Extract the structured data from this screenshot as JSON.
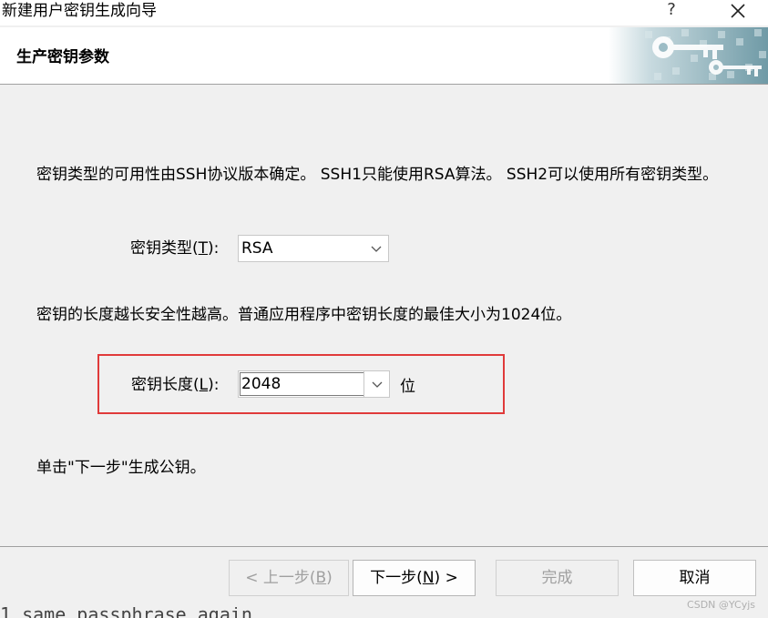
{
  "window": {
    "title": "新建用户密钥生成向导",
    "help_label": "?",
    "close_icon": "close-icon"
  },
  "header": {
    "title": "生产密钥参数",
    "graphic_icon": "keys-icon"
  },
  "content": {
    "type_description": "密钥类型的可用性由SSH协议版本确定。 SSH1只能使用RSA算法。 SSH2可以使用所有密钥类型。",
    "key_type": {
      "label_prefix": "密钥类型(",
      "label_mnemonic": "T",
      "label_suffix": "):",
      "value": "RSA"
    },
    "length_description": "密钥的长度越长安全性越高。普通应用程序中密钥长度的最佳大小为1024位。",
    "key_length": {
      "label_prefix": "密钥长度(",
      "label_mnemonic": "L",
      "label_suffix": "):",
      "value": "2048",
      "unit": "位"
    },
    "instruction": "单击\"下一步\"生成公钥。"
  },
  "footer": {
    "back_prefix": "< 上一步(",
    "back_mnemonic": "B",
    "back_suffix": ")",
    "next_prefix": "下一步(",
    "next_mnemonic": "N",
    "next_suffix": ") >",
    "finish_label": "完成",
    "cancel_label": "取消"
  },
  "watermark": "CSDN @YCyjs",
  "background_text": "1 same passphrase again"
}
